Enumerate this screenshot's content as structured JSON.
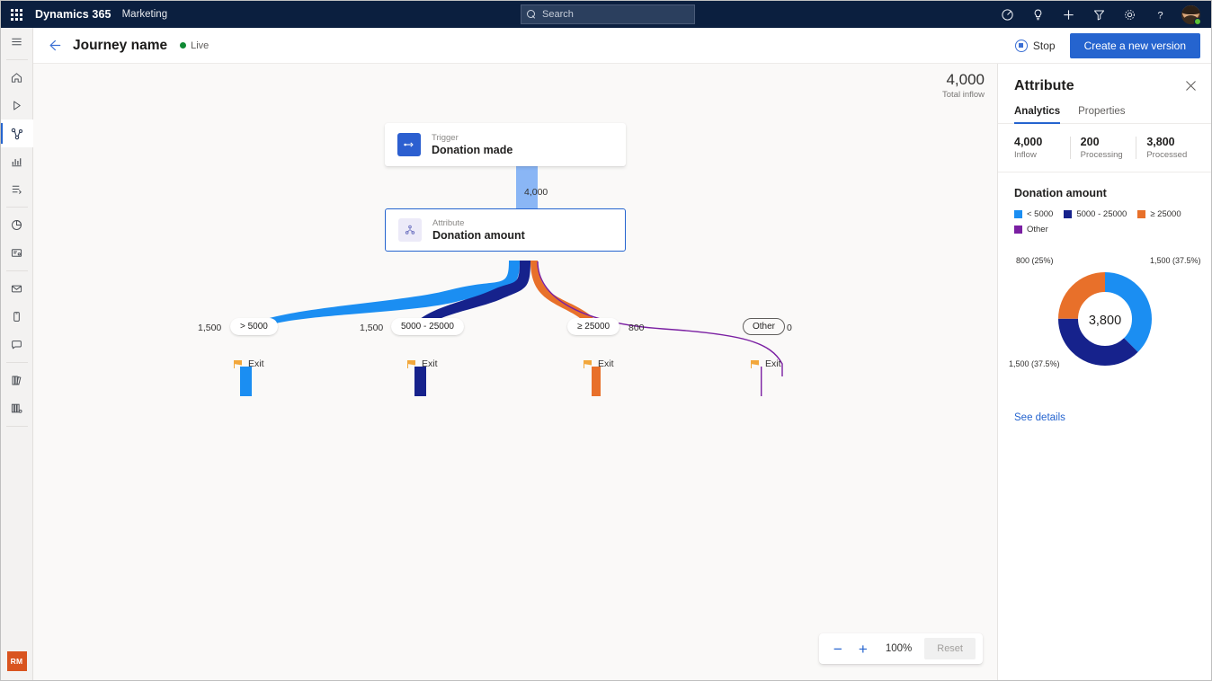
{
  "suitebar": {
    "waffle_label": "app-launcher",
    "brand": "Dynamics 365",
    "app": "Marketing",
    "search_placeholder": "Search",
    "icons": [
      "target-icon",
      "lightbulb-icon",
      "plus-icon",
      "filter-icon",
      "gear-icon",
      "help-icon"
    ],
    "avatar_initials": ""
  },
  "rail": {
    "items": [
      {
        "name": "hamburger-menu",
        "label": "Menu"
      },
      {
        "name": "home",
        "label": "Home"
      },
      {
        "name": "recent",
        "label": "Recent"
      },
      {
        "name": "journeys",
        "label": "Journeys"
      },
      {
        "name": "analytics",
        "label": "Analytics"
      },
      {
        "name": "workflows",
        "label": "Workflows"
      },
      {
        "name": "insights",
        "label": "Insights"
      },
      {
        "name": "forms",
        "label": "Forms"
      },
      {
        "name": "emails",
        "label": "Emails"
      },
      {
        "name": "mobile",
        "label": "Mobile"
      },
      {
        "name": "messages",
        "label": "Messages"
      },
      {
        "name": "library",
        "label": "Library"
      },
      {
        "name": "segments",
        "label": "Segments"
      }
    ],
    "user_initials": "RM"
  },
  "commandbar": {
    "back_label": "Back",
    "title": "Journey name",
    "status": "Live",
    "stop_label": "Stop",
    "primary_label": "Create a new version"
  },
  "canvas": {
    "total_inflow_value": "4,000",
    "total_inflow_label": "Total inflow",
    "nodes": [
      {
        "kind": "Trigger",
        "name": "Donation made",
        "icon": "trigger-icon"
      },
      {
        "kind": "Attribute",
        "name": "Donation amount",
        "icon": "attribute-icon"
      }
    ],
    "trunk_count": "4,000",
    "branches": [
      {
        "count": "1,500",
        "label": "> 5000",
        "color": "#1b8ef2",
        "exit": "Exit",
        "outline": false
      },
      {
        "count": "1,500",
        "label": "5000 - 25000",
        "color": "#16228c",
        "exit": "Exit",
        "outline": false
      },
      {
        "count": "800",
        "label": "≥ 25000",
        "color": "#e8702a",
        "exit": "Exit",
        "outline": false
      },
      {
        "count": "0",
        "label": "Other",
        "color": "#7a1fa2",
        "exit": "Exit",
        "outline": true
      }
    ],
    "zoom": {
      "minus_label": "−",
      "plus_label": "+",
      "percent": "100%",
      "reset_label": "Reset"
    }
  },
  "panel": {
    "title": "Attribute",
    "close_label": "✕",
    "tabs": [
      {
        "label": "Analytics",
        "active": true
      },
      {
        "label": "Properties",
        "active": false
      }
    ],
    "stats": [
      {
        "value": "4,000",
        "label": "Inflow"
      },
      {
        "value": "200",
        "label": "Processing"
      },
      {
        "value": "3,800",
        "label": "Processed"
      }
    ],
    "section_title": "Donation amount",
    "see_details": "See details"
  },
  "chart_data": {
    "type": "pie",
    "title": "Donation amount",
    "center_label": "3,800",
    "total": 3800,
    "legend_position": "top",
    "categories": [
      "< 5000",
      "5000 - 25000",
      "≥ 25000",
      "Other"
    ],
    "values": [
      1500,
      1500,
      800,
      0
    ],
    "percents": [
      37.5,
      37.5,
      25.0,
      0
    ],
    "colors": [
      "#1b8ef2",
      "#16228c",
      "#e8702a",
      "#7a1fa2"
    ],
    "data_labels": [
      {
        "text": "1,500 (37.5%)",
        "category": "< 5000"
      },
      {
        "text": "1,500 (37.5%)",
        "category": "5000 - 25000"
      },
      {
        "text": "800 (25%)",
        "category": "≥ 25000"
      }
    ]
  }
}
